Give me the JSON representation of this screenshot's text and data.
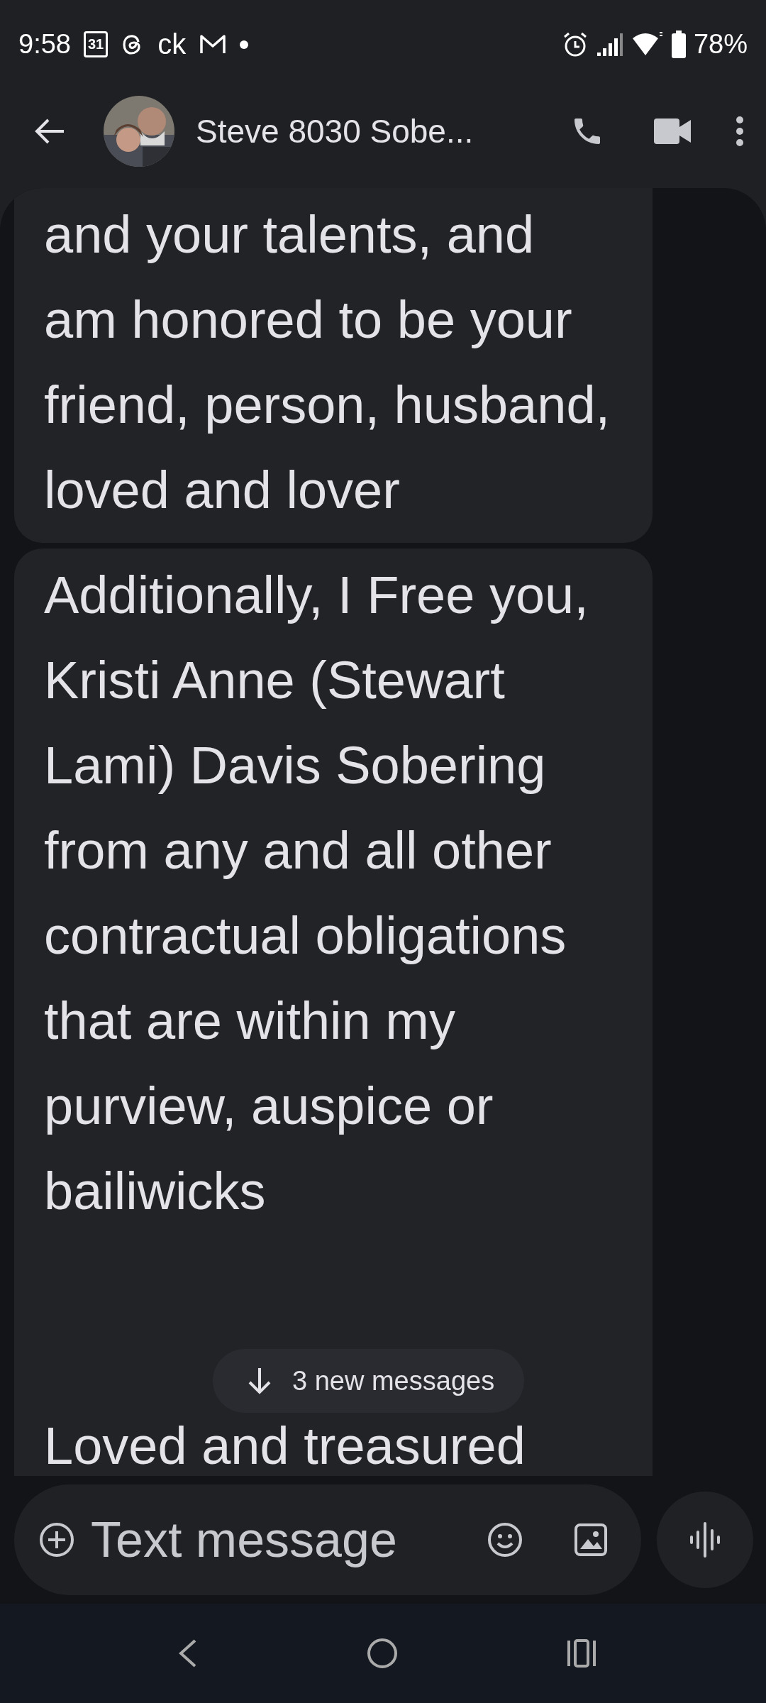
{
  "status_bar": {
    "time": "9:58",
    "calendar_day": "31",
    "carrier_text": "ck",
    "battery": "78%"
  },
  "header": {
    "contact_name": "Steve 8030 Sobe..."
  },
  "messages": [
    {
      "paragraphs": [
        "and your talents, and am honored to be your friend, person, husband, loved and lover"
      ],
      "top_cut": true
    },
    {
      "paragraphs": [
        "Additionally, I Free you, Kristi Anne (Stewart Lami) Davis Sobering from any and all other contractual obligations that are within my purview, auspice or bailiwicks",
        "Loved and treasured"
      ],
      "top_cut": false
    }
  ],
  "new_messages_pill": {
    "label": "3 new messages"
  },
  "composer": {
    "placeholder": "Text message"
  }
}
